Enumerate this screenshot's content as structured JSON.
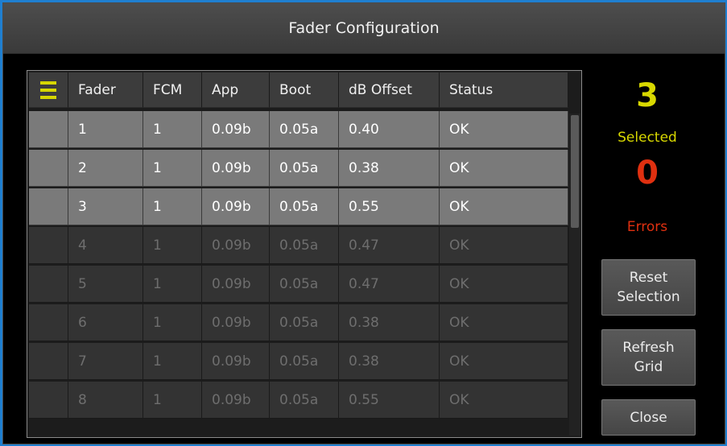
{
  "window": {
    "title": "Fader Configuration"
  },
  "colors": {
    "selected_count": "#d8d800",
    "error_count": "#e03010",
    "menu_icon": "#d6d600"
  },
  "table": {
    "menu_icon": "hamburger-menu-icon",
    "headers": [
      "Fader",
      "FCM",
      "App",
      "Boot",
      "dB Offset",
      "Status"
    ],
    "rows": [
      {
        "selected": true,
        "cells": [
          "1",
          "1",
          "0.09b",
          "0.05a",
          "0.40",
          "OK"
        ]
      },
      {
        "selected": true,
        "cells": [
          "2",
          "1",
          "0.09b",
          "0.05a",
          "0.38",
          "OK"
        ]
      },
      {
        "selected": true,
        "cells": [
          "3",
          "1",
          "0.09b",
          "0.05a",
          "0.55",
          "OK"
        ]
      },
      {
        "selected": false,
        "cells": [
          "4",
          "1",
          "0.09b",
          "0.05a",
          "0.47",
          "OK"
        ]
      },
      {
        "selected": false,
        "cells": [
          "5",
          "1",
          "0.09b",
          "0.05a",
          "0.47",
          "OK"
        ]
      },
      {
        "selected": false,
        "cells": [
          "6",
          "1",
          "0.09b",
          "0.05a",
          "0.38",
          "OK"
        ]
      },
      {
        "selected": false,
        "cells": [
          "7",
          "1",
          "0.09b",
          "0.05a",
          "0.38",
          "OK"
        ]
      },
      {
        "selected": false,
        "cells": [
          "8",
          "1",
          "0.09b",
          "0.05a",
          "0.55",
          "OK"
        ]
      }
    ]
  },
  "summary": {
    "selected_count": "3",
    "selected_label": "Selected",
    "error_count": "0",
    "error_label": "Errors"
  },
  "buttons": {
    "reset_selection": "Reset\nSelection",
    "refresh_grid": "Refresh\nGrid",
    "close": "Close"
  }
}
